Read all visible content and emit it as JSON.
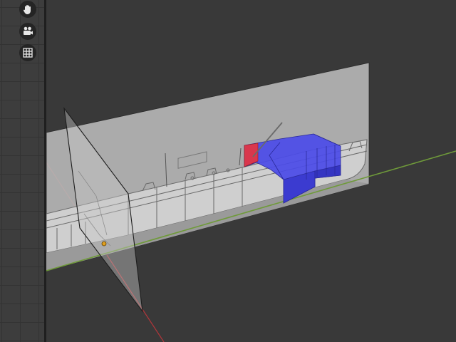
{
  "toolbar": {
    "buttons": [
      {
        "name": "pan-view-button",
        "icon": "hand-icon"
      },
      {
        "name": "camera-view-button",
        "icon": "movie-camera-icon"
      },
      {
        "name": "toggle-grid-button",
        "icon": "grid-icon"
      }
    ]
  },
  "viewport": {
    "background": "#393939",
    "x_axis_color": "#b2363a",
    "y_axis_color": "#6f9a3a",
    "selection_face_color": "#4b4be8",
    "selection_face_side_color": "#3b3bd0",
    "selection_highlight_color": "#e8343c",
    "reference_plane_color": "#b8b8b8",
    "origin_point_color": "#e0a020"
  }
}
